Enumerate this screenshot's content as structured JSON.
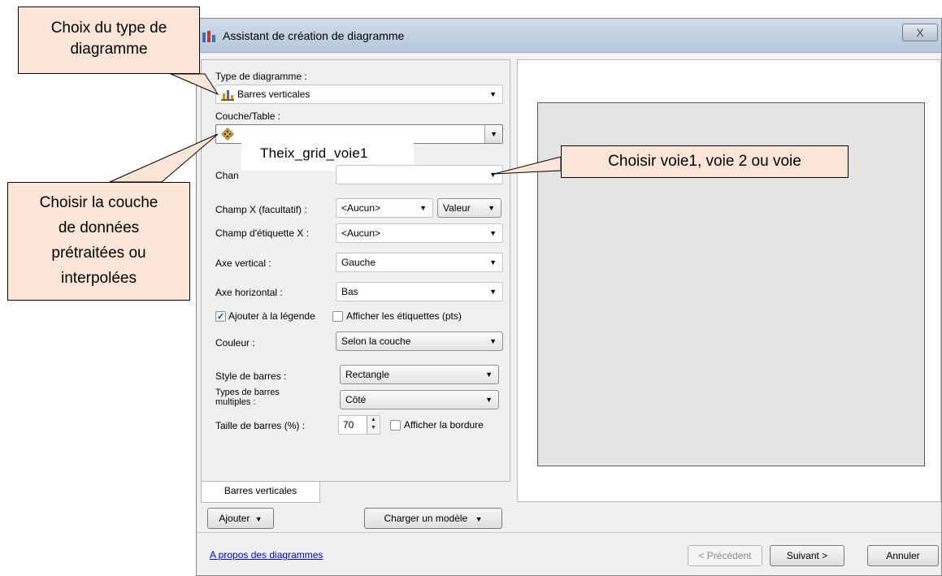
{
  "window": {
    "title": "Assistant de création de diagramme",
    "close_label": "X"
  },
  "form": {
    "type_label": "Type de diagramme :",
    "type_value": "Barres verticales",
    "couche_label": "Couche/Table :",
    "couche_overlay": "Theix_grid_voie1",
    "champ_label_partial": "Chan",
    "champx_label": "Champ X (facultatif) :",
    "champx_value": "<Aucun>",
    "champx_mode": "Valeur",
    "etiquette_label": "Champ d'étiquette X :",
    "etiquette_value": "<Aucun>",
    "axe_v_label": "Axe vertical :",
    "axe_v_value": "Gauche",
    "axe_h_label": "Axe horizontal :",
    "axe_h_value": "Bas",
    "legend_check_label": "Ajouter à la légende",
    "legend_checked": true,
    "labels_check_label": "Afficher les étiquettes (pts)",
    "labels_checked": false,
    "couleur_label": "Couleur :",
    "couleur_value": "Selon la couche",
    "style_label": "Style de barres :",
    "style_value": "Rectangle",
    "multi_label_1": "Types de barres",
    "multi_label_2": "multiples :",
    "multi_value": "Côté",
    "taille_label": "Taille de barres (%) :",
    "taille_value": "70",
    "border_check_label": "Afficher la bordure",
    "border_checked": false
  },
  "tabs": [
    {
      "label": "Barres verticales"
    }
  ],
  "buttons": {
    "add": "Ajouter",
    "load_template": "Charger un modèle",
    "about_link": "A propos des diagrammes",
    "prev": "< Précédent",
    "next": "Suivant >",
    "cancel": "Annuler"
  },
  "callouts": {
    "type_choice": [
      "Choix du type de",
      "diagramme"
    ],
    "layer_choice": [
      "Choisir la couche",
      "de données",
      "prétraitées ou",
      "interpolées"
    ],
    "voie_choice": "Choisir voie1, voie 2 ou voie"
  },
  "colors": {
    "callout_bg": "#fbe5d6",
    "link": "#0000cc"
  }
}
